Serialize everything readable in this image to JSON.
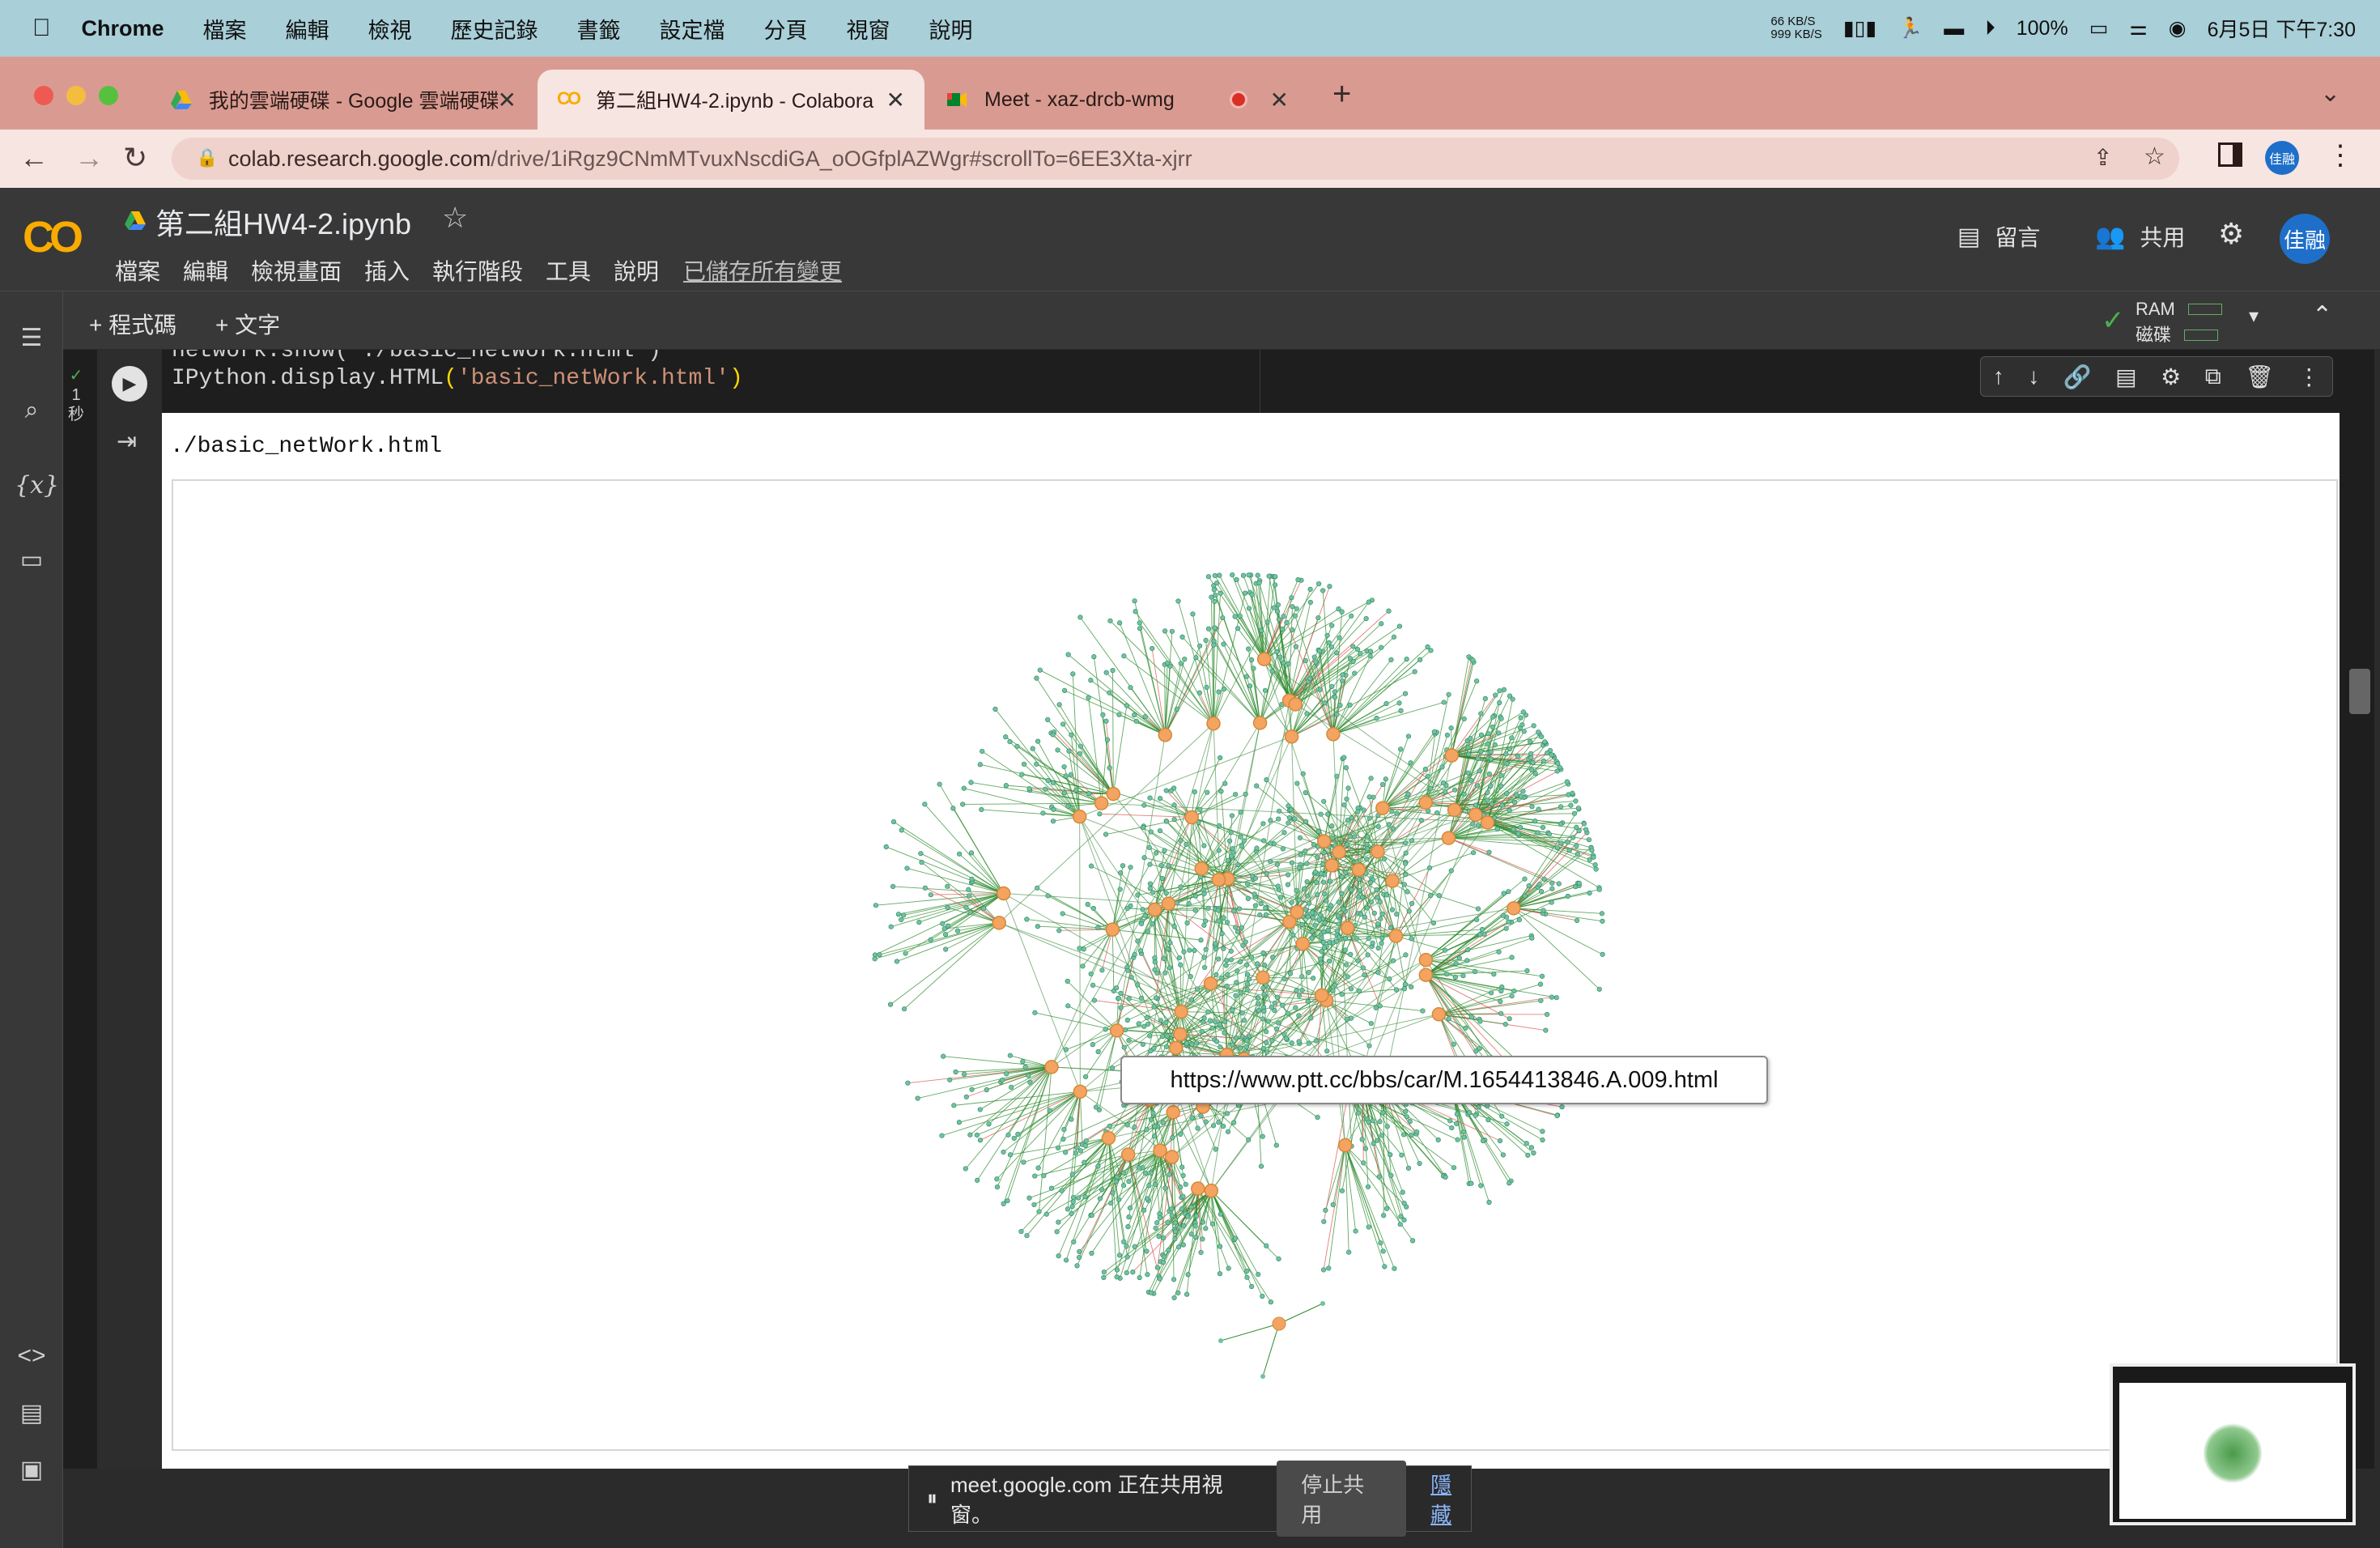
{
  "menubar": {
    "app": "Chrome",
    "items": [
      "檔案",
      "編輯",
      "檢視",
      "歷史記錄",
      "書籤",
      "設定檔",
      "分頁",
      "視窗",
      "說明"
    ],
    "net_up": "66 KB/S",
    "net_down": "999 KB/S",
    "battery": "100%",
    "datetime": "6月5日 下午7:30"
  },
  "tabs": [
    {
      "title": "我的雲端硬碟 - Google 雲端硬碟",
      "icon": "google-drive-icon"
    },
    {
      "title": "第二組HW4-2.ipynb - Colabora",
      "icon": "colab-icon"
    },
    {
      "title": "Meet - xaz-drcb-wmg",
      "icon": "meet-icon"
    }
  ],
  "url": {
    "host": "colab.research.google.com",
    "path": "/drive/1iRgz9CNmMTvuxNscdiGA_oOGfplAZWgr#scrollTo=6EE3Xta-xjrr"
  },
  "profile_badge": "佳融",
  "colab": {
    "logo": "CO",
    "notebook_title": "第二組HW4-2.ipynb",
    "menu": [
      "檔案",
      "編輯",
      "檢視畫面",
      "插入",
      "執行階段",
      "工具",
      "說明"
    ],
    "saved_status": "已儲存所有變更",
    "comment_label": "留言",
    "share_label": "共用",
    "avatar": "佳融",
    "add_code": "+ 程式碼",
    "add_text": "+ 文字",
    "ram_label": "RAM",
    "disk_label": "磁碟"
  },
  "cell": {
    "exec_time_num": "1",
    "exec_time_unit": "秒",
    "code_line1": "network.show('./basic_netWork.html')",
    "code_line2_fn": "IPython.display.HTML",
    "code_line2_arg": "'basic_netWork.html'",
    "output_path": "./basic_netWork.html"
  },
  "tooltip": "https://www.ptt.cc/bbs/car/M.1654413846.A.009.html",
  "screen_share": {
    "text": "meet.google.com 正在共用視窗。",
    "stop": "停止共用",
    "hide": "隱藏"
  },
  "colors": {
    "node_hub": "#f4a460",
    "node_leaf": "#6fc3a0",
    "edge_green": "#2e8b2e",
    "edge_red": "#d9534f"
  }
}
